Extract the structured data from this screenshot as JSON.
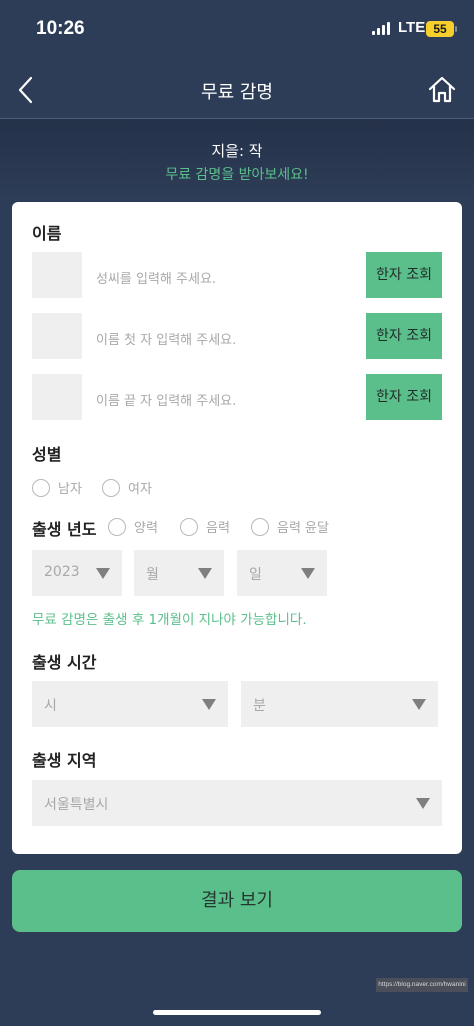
{
  "status_bar": {
    "time": "10:26",
    "network": "LTE",
    "battery": "55"
  },
  "header": {
    "title": "무료 감명",
    "back_icon": "chevron-left-icon",
    "home_icon": "home-icon"
  },
  "intro": {
    "author": "지을: 작",
    "subtitle": "무료 감명을 받아보세요!"
  },
  "name_section": {
    "label": "이름",
    "rows": [
      {
        "placeholder": "성씨를 입력해 주세요.",
        "button": "한자 조회"
      },
      {
        "placeholder": "이름 첫 자 입력해 주세요.",
        "button": "한자 조회"
      },
      {
        "placeholder": "이름 끝 자 입력해 주세요.",
        "button": "한자 조회"
      }
    ]
  },
  "gender_section": {
    "label": "성별",
    "options": [
      "남자",
      "여자"
    ]
  },
  "birth_year_section": {
    "label": "출생 년도",
    "calendar_options": [
      "양력",
      "음력",
      "음력 윤달"
    ],
    "year": "2023",
    "month": "월",
    "day": "일",
    "notice": "무료 감명은 출생 후 1개월이 지나야 가능합니다."
  },
  "birth_time_section": {
    "label": "출생 시간",
    "hour": "시",
    "minute": "분"
  },
  "birth_region_section": {
    "label": "출생 지역",
    "region": "서울특별시"
  },
  "result_button": "결과 보기",
  "watermark": "https://blog.naver.com/hwanini",
  "colors": {
    "background": "#2e3d57",
    "accent": "#5bbf8c",
    "field": "#efefef"
  }
}
